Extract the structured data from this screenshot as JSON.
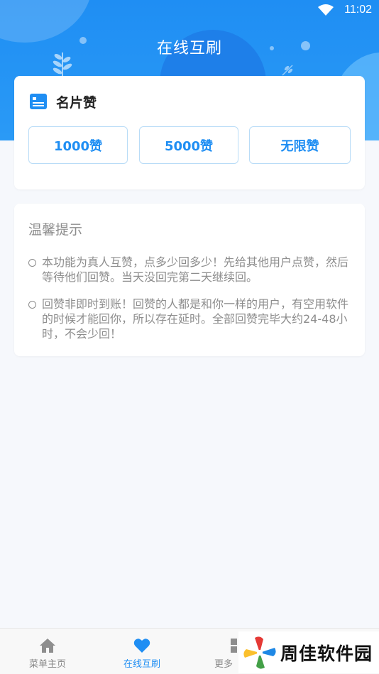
{
  "status_bar": {
    "time": "11:02"
  },
  "header": {
    "title": "在线互刷"
  },
  "likes_card": {
    "title": "名片赞",
    "options": [
      "1000赞",
      "5000赞",
      "无限赞"
    ]
  },
  "tips": {
    "title": "温馨提示",
    "items": [
      "本功能为真人互赞，点多少回多少！先给其他用户点赞，然后等待他们回赞。当天没回完第二天继续回。",
      "回赞非即时到账！回赞的人都是和你一样的用户，有空用软件的时候才能回你，所以存在延时。全部回赞完毕大约24-48小时，不会少回！"
    ]
  },
  "bottom_nav": {
    "items": [
      "菜单主页",
      "在线互刷",
      "更多"
    ]
  },
  "watermark": {
    "text": "周佳软件园"
  },
  "colors": {
    "accent": "#1f8ef3",
    "header_bg": "#2a9af6",
    "muted_text": "#8d8d8d"
  }
}
